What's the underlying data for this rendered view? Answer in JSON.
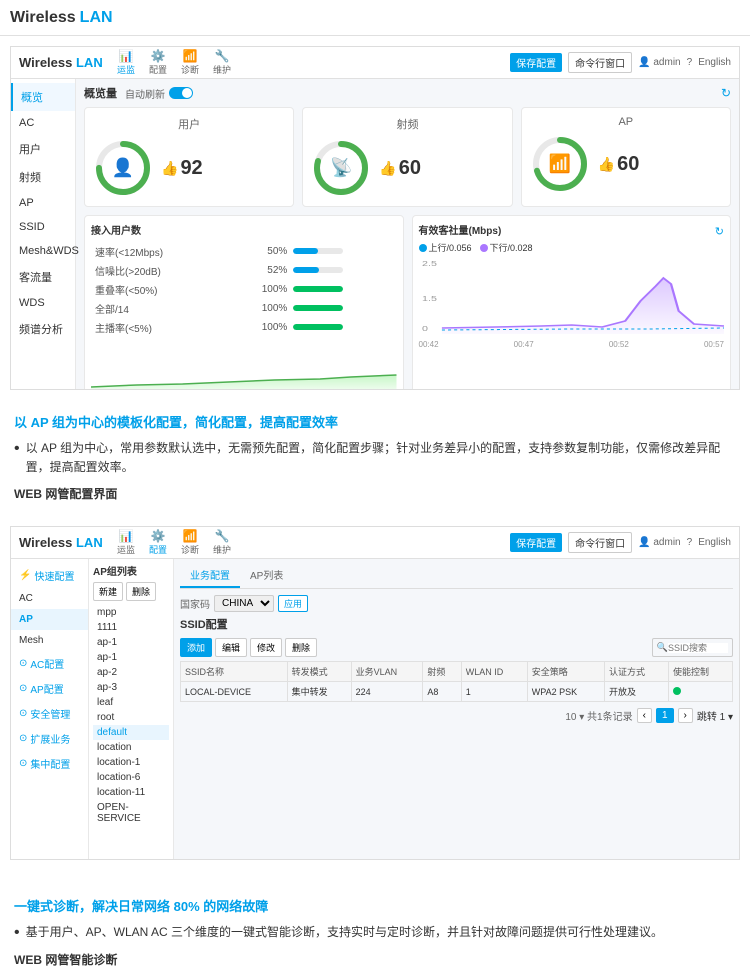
{
  "header": {
    "logo_wireless": "Wireless",
    "logo_lan": "LAN",
    "nav_items": [
      {
        "label": "运监",
        "icon": "📊",
        "active": true
      },
      {
        "label": "配置",
        "icon": "⚙️",
        "active": false
      },
      {
        "label": "诊断",
        "icon": "📶",
        "active": false
      },
      {
        "label": "维护",
        "icon": "🔧",
        "active": false
      }
    ],
    "btn_save": "保存配置",
    "btn_cmd": "命令行窗口",
    "user": "admin",
    "lang": "English"
  },
  "screenshot1": {
    "sidebar": [
      {
        "label": "概览",
        "active": true
      },
      {
        "label": "AC"
      },
      {
        "label": "用户"
      },
      {
        "label": "射频"
      },
      {
        "label": "AP"
      },
      {
        "label": "SSID"
      },
      {
        "label": "Mesh&WDS"
      },
      {
        "label": "客流量"
      },
      {
        "label": "WDS"
      },
      {
        "label": "频谱分析"
      }
    ],
    "overview": {
      "title": "概览",
      "auto_refresh": "自动刷新",
      "stats": [
        {
          "title": "用户",
          "value": 92,
          "percent": 75,
          "color": "#4CAF50"
        },
        {
          "title": "射频",
          "value": 60,
          "percent": 80,
          "color": "#4CAF50"
        },
        {
          "title": "AP",
          "value": 60,
          "percent": 70,
          "color": "#4CAF50"
        }
      ],
      "user_details": {
        "title": "接入用户数",
        "rows": [
          {
            "label": "速率(<12Mbps)",
            "val": "50%",
            "pct": 50
          },
          {
            "label": "信噪比(>20dB)",
            "val": "52%",
            "pct": 52
          },
          {
            "label": "重叠率(<50%)",
            "val": "100%",
            "pct": 100
          },
          {
            "label": "全部/14",
            "val": "100%",
            "pct": 100
          },
          {
            "label": "主播率(<5%)",
            "val": "100%",
            "pct": 100
          }
        ]
      },
      "ap_details": {
        "title": "有效客社量(Mbps)",
        "legend": [
          "上行/0.056",
          "下行/0.028"
        ]
      },
      "chart_times": [
        "00:42",
        "00:47",
        "00:52",
        "00:57"
      ]
    }
  },
  "text_section1": {
    "heading": "以 AP 组为中心的模板化配置，简化配置，提高配置效率",
    "bullets": [
      "以 AP 组为中心，常用参数默认选中，无需预先配置，简化配置步骤；针对业务差异小的配置，支持参数复制功能，仅需修改差异配置，提高配置效率。"
    ],
    "sub_heading": "WEB 网管配置界面"
  },
  "screenshot2": {
    "sidebar": [
      {
        "label": "⚡ 快速配置",
        "active": false
      },
      {
        "label": "AC",
        "active": false
      },
      {
        "label": "AP",
        "active": true,
        "arrow": true
      },
      {
        "label": "Mesh",
        "active": false
      },
      {
        "label": "⊙ AC配置",
        "active": false
      },
      {
        "label": "⊙ AP配置",
        "active": false
      },
      {
        "label": "⊙ 安全管理",
        "active": false
      },
      {
        "label": "⊙ 扩展业务",
        "active": false
      },
      {
        "label": "⊙ 集中配置",
        "active": false
      }
    ],
    "ap_list_title": "AP组列表",
    "ap_btns": [
      "新建",
      "删除"
    ],
    "ap_items": [
      {
        "name": "mpp",
        "active": false
      },
      {
        "name": "1111",
        "active": false
      },
      {
        "name": "ap-1",
        "active": false
      },
      {
        "name": "ap-1",
        "active": false
      },
      {
        "name": "ap-2",
        "active": false
      },
      {
        "name": "ap-3",
        "active": false
      },
      {
        "name": "leaf",
        "active": false
      },
      {
        "name": "root",
        "active": false
      },
      {
        "name": "default",
        "active": true
      },
      {
        "name": "location",
        "active": false
      },
      {
        "name": "location-1",
        "active": false
      },
      {
        "name": "location-6",
        "active": false
      },
      {
        "name": "location-11",
        "active": false
      },
      {
        "name": "OPEN-SERVICE",
        "active": false
      }
    ],
    "tabs": [
      {
        "label": "业务配置",
        "active": true
      },
      {
        "label": "AP列表",
        "active": false
      }
    ],
    "filter_label": "国家码",
    "filter_value": "CHINA",
    "filter_btn": "应用",
    "ssid_title": "SSID配置",
    "ssid_actions": [
      "添加",
      "编辑",
      "修改",
      "删除"
    ],
    "ssid_search_placeholder": "SSID搜索",
    "ssid_columns": [
      "SSID名称",
      "转发模式",
      "业务VLAN",
      "射频",
      "WLAN ID",
      "安全策略",
      "认证方式",
      "使能控制"
    ],
    "ssid_rows": [
      {
        "name": "LOCAL-DEVICE",
        "mode": "集中转发",
        "vlan": "224",
        "radio": "A8",
        "wlan_id": "1",
        "security": "WPA2 PSK",
        "auth": "开放及",
        "status": "green"
      }
    ],
    "pagination": {
      "total_prefix": "共",
      "total": 1,
      "total_suffix": "条记录",
      "current_page": 1,
      "total_pages": 1
    }
  },
  "text_section2": {
    "heading": "一键式诊断，解决日常网络 80% 的网络故障",
    "bullets": [
      "基于用户、AP、WLAN AC 三个维度的一键式智能诊断，支持实时与定时诊断，并且针对故障问题提供可行性处理建议。"
    ],
    "sub_heading": "WEB 网管智能诊断"
  }
}
